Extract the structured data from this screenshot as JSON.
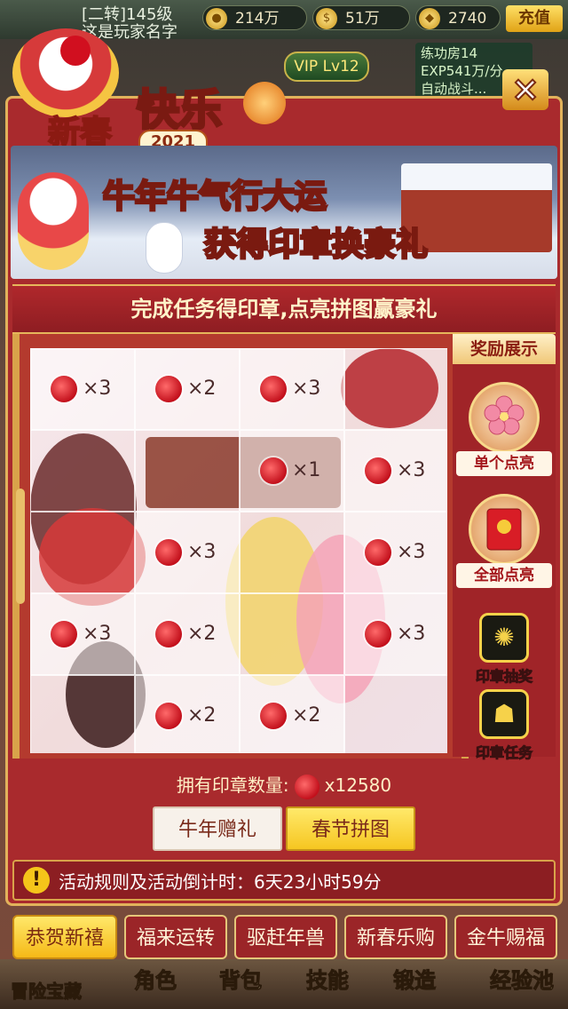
{
  "status_bar": {
    "player_level": "[二转]145级",
    "player_name": "这是玩家名字",
    "resource_1": "214万",
    "resource_2": "51万",
    "resource_3": "2740",
    "recharge_label": "充值"
  },
  "background": {
    "room_name": "练功房14",
    "room_exp": "EXP541万/分",
    "room_auto": "自动战斗..."
  },
  "header": {
    "logo_line_1": "新春",
    "logo_line_2": "快乐",
    "logo_year": "2021",
    "vip_badge": "VIP Lv12",
    "close_label": "×"
  },
  "banner": {
    "line_1": "牛年牛气行大运",
    "line_2_prefix": "获得印章",
    "line_2_highlight": "换豪礼"
  },
  "title_strip": "完成任务得印章,点亮拼图赢豪礼",
  "puzzle": {
    "pieces": [
      {
        "count": "×3"
      },
      {
        "count": "×2"
      },
      {
        "count": "×3"
      },
      {
        "count": ""
      },
      {
        "count": ""
      },
      {
        "count": ""
      },
      {
        "count": "×1"
      },
      {
        "count": "×3"
      },
      {
        "count": ""
      },
      {
        "count": "×3"
      },
      {
        "count": ""
      },
      {
        "count": "×3"
      },
      {
        "count": "×3"
      },
      {
        "count": "×2"
      },
      {
        "count": ""
      },
      {
        "count": "×3"
      },
      {
        "count": ""
      },
      {
        "count": "×2"
      },
      {
        "count": "×2"
      },
      {
        "count": ""
      }
    ]
  },
  "rewards": {
    "heading": "奖励展示",
    "single_light": "单个点亮",
    "all_light": "全部点亮",
    "seal_lottery": "印章抽奖",
    "seal_task": "印章任务"
  },
  "owned": {
    "label": "拥有印章数量:",
    "value": "x12580"
  },
  "tabs": {
    "gift": "牛年赠礼",
    "puzzle": "春节拼图"
  },
  "rules": {
    "icon": "!",
    "text": "活动规则及活动倒计时：6天23小时59分"
  },
  "activity_tabs": [
    "恭贺新禧",
    "福来运转",
    "驱赶年兽",
    "新春乐购",
    "金牛赐福"
  ],
  "bottom_nav": [
    "冒险宝藏",
    "角色",
    "背包",
    "技能",
    "锻造",
    "经验池"
  ],
  "colors": {
    "panel_red": "#a92a2d",
    "gold": "#e2b25b",
    "seal_red": "#c3101c",
    "active_tab": "#f6c621"
  }
}
